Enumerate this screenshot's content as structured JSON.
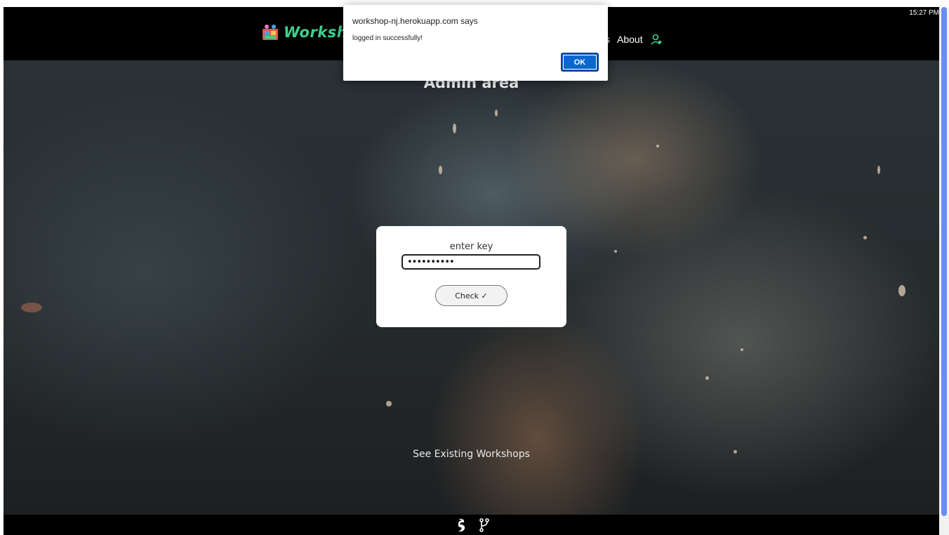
{
  "system": {
    "clock": "15:27 PM"
  },
  "navbar": {
    "logo_text": "Worksh",
    "nav_items": [
      "s",
      "About"
    ],
    "logo_icon": "workshop-logo-icon",
    "user_icon": "user-icon"
  },
  "page": {
    "title": "Admin area",
    "key_form": {
      "label": "enter key",
      "input_value": "••••••••••",
      "check_button": "Check ✓"
    },
    "see_link": "See Existing Workshops"
  },
  "footer": {
    "icons": [
      "dragon-logo-icon",
      "git-icon"
    ]
  },
  "dialog": {
    "title": "workshop-nj.herokuapp.com says",
    "message": "logged in successfully!",
    "ok_label": "OK"
  },
  "colors": {
    "accent_green": "#3ecf8e",
    "dialog_button": "#0b67d0",
    "scroll_thumb": "#6b8cf5"
  }
}
